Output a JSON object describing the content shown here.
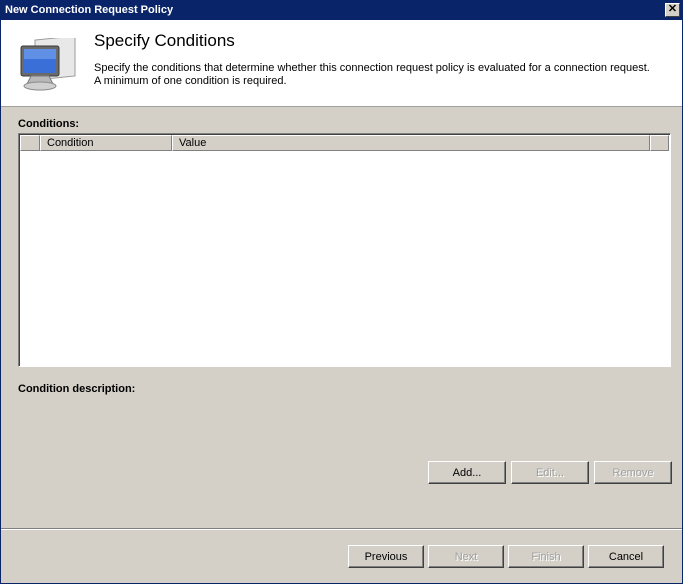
{
  "window": {
    "title": "New Connection Request Policy",
    "close_glyph": "✕"
  },
  "header": {
    "icon": "monitor-icon",
    "title": "Specify Conditions",
    "desc_line1": "Specify the conditions that determine whether this connection request policy is evaluated for a connection request.",
    "desc_line2": "A minimum of one condition is required."
  },
  "conditions": {
    "label": "Conditions:",
    "columns": [
      "",
      "Condition",
      "Value",
      ""
    ],
    "rows": []
  },
  "description": {
    "label": "Condition description:"
  },
  "actions": {
    "add": "Add...",
    "edit": "Edit...",
    "remove": "Remove"
  },
  "footer": {
    "previous": "Previous",
    "next": "Next",
    "finish": "Finish",
    "cancel": "Cancel"
  }
}
